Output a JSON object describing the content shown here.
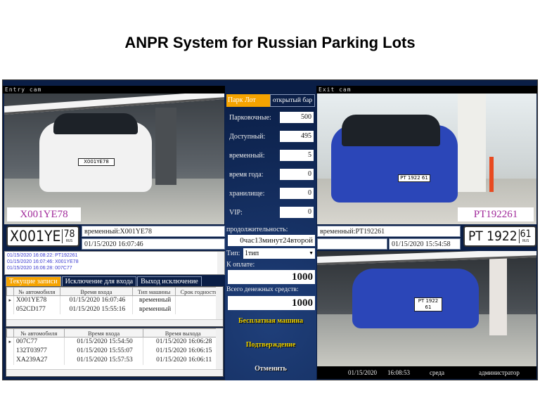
{
  "slide_title": "ANPR System for Russian Parking Lots",
  "entry": {
    "cam_label": "Entry cam",
    "plate_text": "X001YE78",
    "plate_img": {
      "main": "X001YE",
      "region": "78",
      "country": "RUS"
    },
    "type_line": "временный:X001YE78",
    "time": "01/15/2020 16:07:46",
    "car_plate_small": "X001YE78"
  },
  "exit": {
    "cam_label": "Exit cam",
    "plate_text": "PT192261",
    "plate_img": {
      "main": "PT 1922",
      "region": "61",
      "country": "RUS"
    },
    "type_line": "временный:PT192261",
    "extra": "",
    "time": "01/15/2020 15:54:58",
    "car_plate_small": "PT 1922 61"
  },
  "log": [
    "01/15/2020 16:08:22: PT192261",
    "01/15/2020 16:07:46: X001YE78",
    "01/15/2020 16:06:28: 007C77"
  ],
  "tabs": [
    {
      "label": "Текущие записи",
      "active": true
    },
    {
      "label": "Исключение для входа",
      "active": false
    },
    {
      "label": "Выход исключение",
      "active": false
    }
  ],
  "current_grid": {
    "headers": [
      "№ автомобиля",
      "Время входа",
      "Тип машины",
      "Срок годности"
    ],
    "rows": [
      [
        "X001YE78",
        "01/15/2020 16:07:46",
        "временный",
        ""
      ],
      [
        "052CD177",
        "01/15/2020 15:55:16",
        "временный",
        ""
      ]
    ]
  },
  "history_grid": {
    "headers": [
      "№ автомобиля",
      "Время входа",
      "Время выхода"
    ],
    "rows": [
      [
        "007C77",
        "01/15/2020 15:54:50",
        "01/15/2020 16:06:28"
      ],
      [
        "132T03977",
        "01/15/2020 15:55:07",
        "01/15/2020 16:06:15"
      ],
      [
        "XA239A27",
        "01/15/2020 15:57:53",
        "01/15/2020 16:06:11"
      ]
    ]
  },
  "center": {
    "tab_park": "Парк Лот",
    "tab_open": "открытый бар",
    "stats": [
      {
        "label": "Парковочные:",
        "value": "500"
      },
      {
        "label": "Доступный:",
        "value": "495"
      },
      {
        "label": "временный:",
        "value": "5"
      },
      {
        "label": "время года:",
        "value": "0"
      },
      {
        "label": "хранилище:",
        "value": "0"
      },
      {
        "label": "VIP:",
        "value": "0"
      }
    ],
    "duration_label": "продолжительность:",
    "duration_value": "0час13минут24второй",
    "type_label": "Тип:",
    "type_value": "1тип",
    "pay_label": "К оплате:",
    "pay_value": "1000",
    "total_label": "Всего денежных средств:",
    "total_value": "1000",
    "free_car": "Бесплатная машина",
    "confirm": "Подтверждение",
    "cancel": "Отменить"
  },
  "status": {
    "date": "01/15/2020",
    "time": "16:08:53",
    "weekday": "среда",
    "user": "администратор"
  },
  "colors": {
    "accent": "#f5a300",
    "panel": "#0a1e46",
    "button_text": "#f0d400",
    "plate_label": "#a0289a",
    "log_text": "#3a3ad0"
  }
}
